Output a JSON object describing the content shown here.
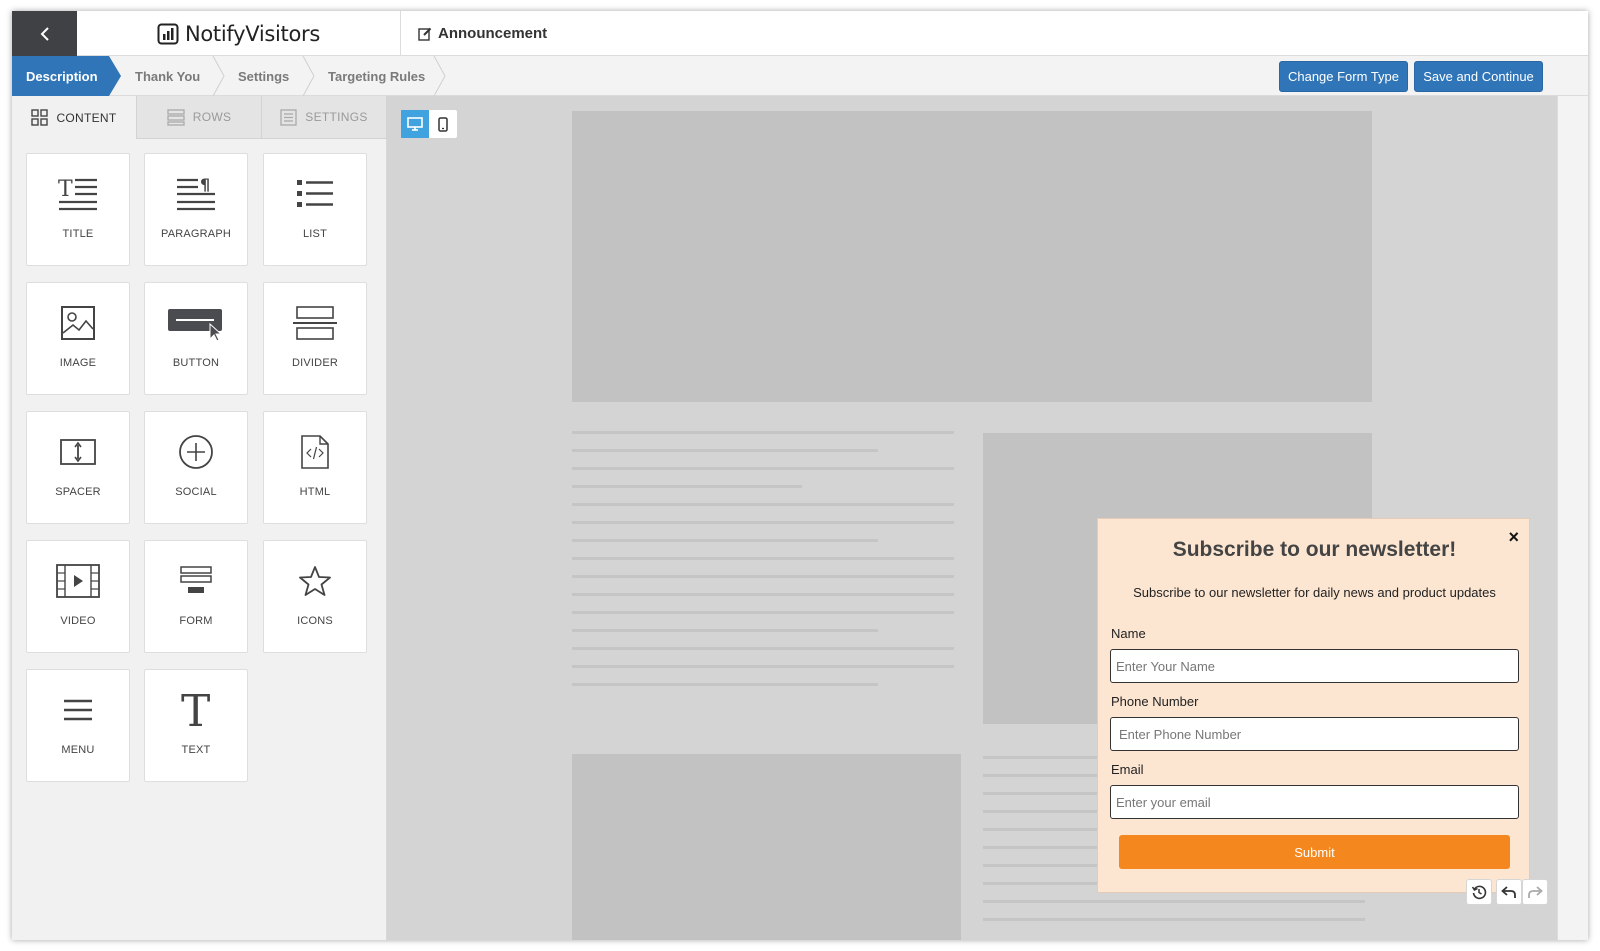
{
  "header": {
    "back_icon": "chevron-left-icon",
    "logo_text": "NotifyVisitors",
    "page_title": "Announcement",
    "page_title_icon": "edit-icon"
  },
  "steps": [
    {
      "label": "Description",
      "active": true
    },
    {
      "label": "Thank You",
      "active": false
    },
    {
      "label": "Settings",
      "active": false
    },
    {
      "label": "Targeting Rules",
      "active": false
    }
  ],
  "actions": {
    "change_form_type": "Change Form Type",
    "save_continue": "Save and Continue"
  },
  "tabs": [
    {
      "label": "CONTENT",
      "icon": "grid-icon",
      "active": true
    },
    {
      "label": "ROWS",
      "icon": "rows-icon",
      "active": false
    },
    {
      "label": "SETTINGS",
      "icon": "settings-list-icon",
      "active": false
    }
  ],
  "blocks": [
    {
      "label": "TITLE",
      "icon": "title-icon"
    },
    {
      "label": "PARAGRAPH",
      "icon": "paragraph-icon"
    },
    {
      "label": "LIST",
      "icon": "list-icon"
    },
    {
      "label": "IMAGE",
      "icon": "image-icon"
    },
    {
      "label": "BUTTON",
      "icon": "button-icon"
    },
    {
      "label": "DIVIDER",
      "icon": "divider-icon"
    },
    {
      "label": "SPACER",
      "icon": "spacer-icon"
    },
    {
      "label": "SOCIAL",
      "icon": "social-icon"
    },
    {
      "label": "HTML",
      "icon": "html-icon"
    },
    {
      "label": "VIDEO",
      "icon": "video-icon"
    },
    {
      "label": "FORM",
      "icon": "form-icon"
    },
    {
      "label": "ICONS",
      "icon": "star-icon"
    },
    {
      "label": "MENU",
      "icon": "menu-icon"
    },
    {
      "label": "TEXT",
      "icon": "text-icon"
    }
  ],
  "device_toggle": {
    "active": "desktop"
  },
  "popup": {
    "title": "Subscribe to our newsletter!",
    "subtitle": "Subscribe to our newsletter for daily news and product updates",
    "close": "×",
    "name_label": "Name",
    "name_placeholder": "Enter Your Name",
    "phone_label": "Phone Number",
    "phone_placeholder": "Enter Phone Number",
    "email_label": "Email",
    "email_placeholder": "Enter your email",
    "submit": "Submit"
  },
  "colors": {
    "primary": "#2f75b8",
    "submit": "#f5871f",
    "popup_bg": "#fce6d2",
    "device_active": "#41a2e0"
  }
}
